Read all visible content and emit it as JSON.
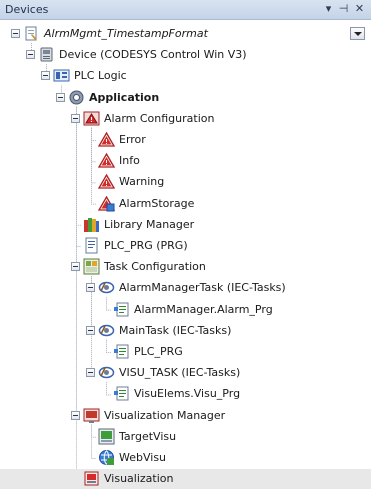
{
  "panel": {
    "title": "Devices",
    "pin_glyph": "▾",
    "autohide_glyph": "⊣",
    "close_glyph": "✕"
  },
  "tree": [
    {
      "id": "root",
      "label": "AlrmMgmt_TimestampFormat",
      "italic": true,
      "icon": "project-icon",
      "depth": 0,
      "toggle": true
    },
    {
      "id": "device",
      "label": "Device (CODESYS Control Win V3)",
      "icon": "device-icon",
      "depth": 1,
      "toggle": true
    },
    {
      "id": "plc-logic",
      "label": "PLC Logic",
      "icon": "plc-logic-icon",
      "depth": 2,
      "toggle": true
    },
    {
      "id": "application",
      "label": "Application",
      "bold": true,
      "icon": "application-gear-icon",
      "depth": 3,
      "toggle": true
    },
    {
      "id": "alarm-config",
      "label": "Alarm Configuration",
      "icon": "alarm-configuration-icon",
      "depth": 4,
      "toggle": true
    },
    {
      "id": "error",
      "label": "Error",
      "icon": "alarm-class-icon",
      "depth": 5
    },
    {
      "id": "info",
      "label": "Info",
      "icon": "alarm-class-icon",
      "depth": 5
    },
    {
      "id": "warning",
      "label": "Warning",
      "icon": "alarm-class-icon",
      "depth": 5
    },
    {
      "id": "alarm-storage",
      "label": "AlarmStorage",
      "icon": "alarm-storage-icon",
      "depth": 5
    },
    {
      "id": "library-manager",
      "label": "Library Manager",
      "icon": "library-books-icon",
      "depth": 4
    },
    {
      "id": "plc-prg",
      "label": "PLC_PRG (PRG)",
      "icon": "program-icon",
      "depth": 4
    },
    {
      "id": "task-config",
      "label": "Task Configuration",
      "icon": "task-configuration-icon",
      "depth": 4,
      "toggle": true
    },
    {
      "id": "alarm-manager-task",
      "label": "AlarmManagerTask (IEC-Tasks)",
      "icon": "task-icon",
      "depth": 5,
      "toggle": true
    },
    {
      "id": "alarm-manager-prg",
      "label": "AlarmManager.Alarm_Prg",
      "icon": "program-call-icon",
      "depth": 6
    },
    {
      "id": "main-task",
      "label": "MainTask (IEC-Tasks)",
      "icon": "task-icon",
      "depth": 5,
      "toggle": true
    },
    {
      "id": "main-plc-prg",
      "label": "PLC_PRG",
      "icon": "program-call-icon",
      "depth": 6
    },
    {
      "id": "visu-task",
      "label": "VISU_TASK (IEC-Tasks)",
      "icon": "task-icon",
      "depth": 5,
      "toggle": true
    },
    {
      "id": "visu-elems",
      "label": "VisuElems.Visu_Prg",
      "icon": "program-call-icon",
      "depth": 6
    },
    {
      "id": "visu-manager",
      "label": "Visualization Manager",
      "icon": "visualization-manager-icon",
      "depth": 4,
      "toggle": true
    },
    {
      "id": "target-visu",
      "label": "TargetVisu",
      "icon": "target-visu-icon",
      "depth": 5
    },
    {
      "id": "web-visu",
      "label": "WebVisu",
      "icon": "web-visu-icon",
      "depth": 5
    },
    {
      "id": "visualization",
      "label": "Visualization",
      "icon": "visualization-icon",
      "depth": 4,
      "selected": true
    }
  ]
}
